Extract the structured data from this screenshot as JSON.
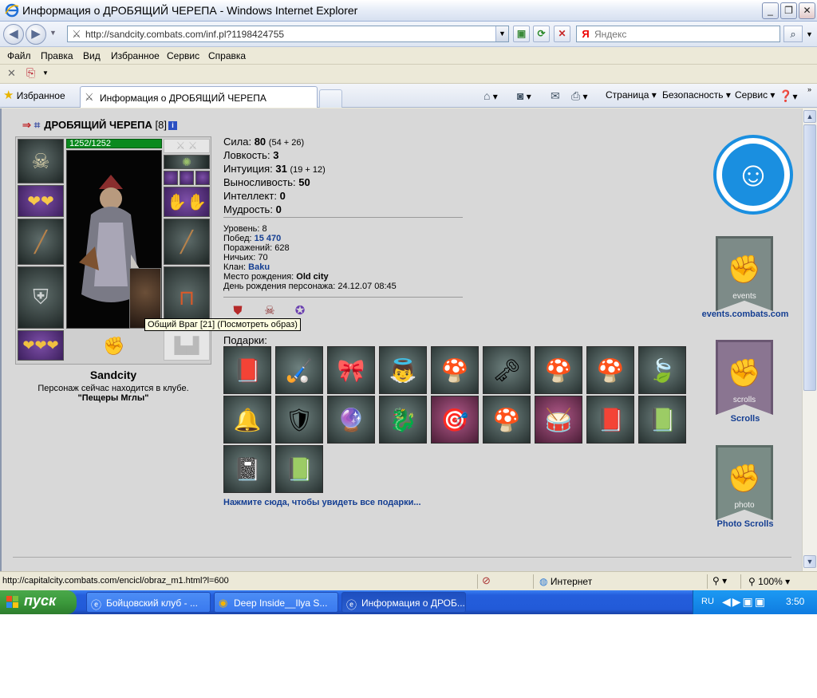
{
  "window": {
    "title": "Информация о ДРОБЯЩИЙ ЧЕРЕПА - Windows Internet Explorer"
  },
  "address_bar": {
    "url": "http://sandcity.combats.com/inf.pl?1198424755",
    "search_placeholder": "Яндекс"
  },
  "menu": [
    "Файл",
    "Правка",
    "Вид",
    "Избранное",
    "Сервис",
    "Справка"
  ],
  "tabs": {
    "favorites_label": "Избранное",
    "active_tab_label": "Информация о ДРОБЯЩИЙ ЧЕРЕПА"
  },
  "command_bar": {
    "page_label": "Страница",
    "security_label": "Безопасность",
    "tools_label": "Сервис"
  },
  "character": {
    "name": "ДРОБЯЩИЙ ЧЕРЕПА",
    "level": "[8]",
    "hp_text": "1252/1252",
    "hp_fraction": 1.0,
    "city_name": "Sandcity",
    "presence_text": "Персонаж сейчас находится в клубе.",
    "presence_place": "\"Пещеры Мглы\""
  },
  "stats": [
    {
      "label": "Сила:",
      "value": "80",
      "detail": "(54 + 26)"
    },
    {
      "label": "Ловкость:",
      "value": "3",
      "detail": ""
    },
    {
      "label": "Интуиция:",
      "value": "31",
      "detail": "(19 + 12)"
    },
    {
      "label": "Выносливость:",
      "value": "50",
      "detail": ""
    },
    {
      "label": "Интеллект:",
      "value": "0",
      "detail": ""
    },
    {
      "label": "Мудрость:",
      "value": "0",
      "detail": ""
    }
  ],
  "info": {
    "level_label": "Уровень:",
    "level_value": "8",
    "wins_label": "Побед:",
    "wins_value": "15 470",
    "losses_label": "Поражений:",
    "losses_value": "628",
    "draws_label": "Ничьих:",
    "draws_value": "70",
    "clan_label": "Клан:",
    "clan_value": "Baku",
    "birthplace_label": "Место рождения:",
    "birthplace_value": "Old city",
    "birthday_label": "День рождения персонажа:",
    "birthday_value": "24.12.07 08:45"
  },
  "tooltip": "Общий Враг [21] (Посмотреть образ)",
  "gifts": {
    "label": "Подарки:",
    "all_link": "Нажмите сюда, чтобы увидеть все подарки...",
    "items": [
      "book-icon",
      "hockey-stick-icon",
      "bow-tie-icon",
      "angel-figure-icon",
      "mushroom-icon",
      "heart-key-icon",
      "mushroom-icon",
      "mushroom-icon",
      "leaf-coin-icon",
      "bell-icon",
      "shield-mask-icon",
      "glass-orb-icon",
      "twin-dragons-icon",
      "target-icon",
      "mushroom-icon",
      "drum-icon",
      "red-book-icon",
      "green-book-icon",
      "dark-book-icon",
      "green-book-icon"
    ]
  },
  "right_panel": {
    "events_word": "events",
    "events_link": "events.combats.com",
    "scrolls_word": "scrolls",
    "scrolls_link": "Scrolls",
    "photo_word": "photo",
    "photo_link": "Photo Scrolls"
  },
  "status_bar": {
    "url": "http://capitalcity.combats.com/encicl/obraz_m1.html?l=600",
    "zone": "Интернет",
    "zoom": "100%"
  },
  "taskbar": {
    "start_label": "пуск",
    "tasks": [
      "Бойцовский клуб - ...",
      "Deep Inside__Ilya S...",
      "Информация о ДРОБ..."
    ],
    "lang": "RU",
    "clock": "3:50"
  },
  "colors": {
    "link": "#143e92",
    "hp_green": "#0a8a1e",
    "accent_blue": "#1a8fe0"
  }
}
